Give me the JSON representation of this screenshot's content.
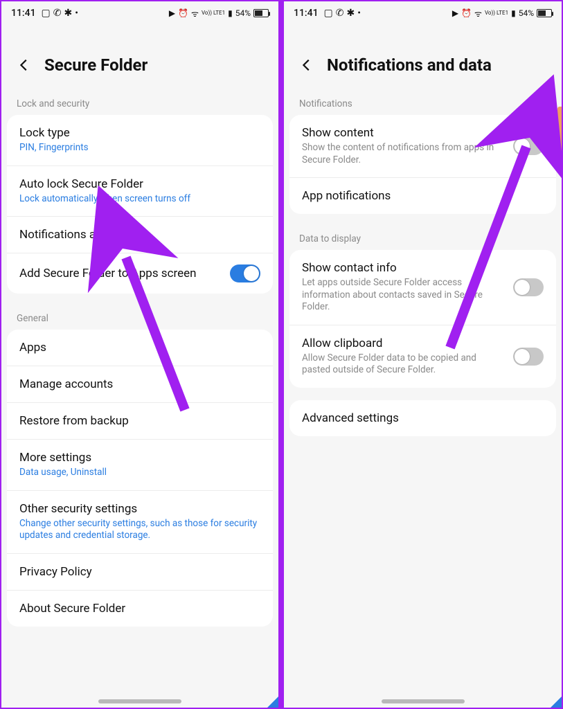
{
  "statusbar": {
    "time": "11:41",
    "battery_text": "54%",
    "net_label": "Vo)) LTE1",
    "left_icons": [
      "image-icon",
      "whatsapp-icon",
      "slack-icon",
      "dot-icon"
    ],
    "right_icons": [
      "youtube-icon",
      "alarm-icon",
      "wifi-icon",
      "net-label",
      "signal-icon"
    ]
  },
  "screens": {
    "left": {
      "title": "Secure Folder",
      "sections": [
        {
          "label": "Lock and security",
          "items": [
            {
              "title": "Lock type",
              "sub": "PIN, Fingerprints",
              "subColor": "blue"
            },
            {
              "title": "Auto lock Secure Folder",
              "sub": "Lock automatically when screen turns off",
              "subColor": "blue"
            },
            {
              "title": "Notifications and data"
            },
            {
              "title": "Add Secure Folder to Apps screen",
              "toggle": "on"
            }
          ]
        },
        {
          "label": "General",
          "items": [
            {
              "title": "Apps"
            },
            {
              "title": "Manage accounts"
            },
            {
              "title": "Restore from backup"
            },
            {
              "title": "More settings",
              "sub": "Data usage, Uninstall",
              "subColor": "blue"
            },
            {
              "title": "Other security settings",
              "sub": "Change other security settings, such as those for security updates and credential storage.",
              "subColor": "blue"
            },
            {
              "title": "Privacy Policy"
            },
            {
              "title": "About Secure Folder"
            }
          ]
        }
      ]
    },
    "right": {
      "title": "Notifications and data",
      "sections": [
        {
          "label": "Notifications",
          "items": [
            {
              "title": "Show content",
              "sub": "Show the content of notifications from apps in Secure Folder.",
              "subColor": "gray",
              "toggle": "off"
            },
            {
              "title": "App notifications"
            }
          ]
        },
        {
          "label": "Data to display",
          "items": [
            {
              "title": "Show contact info",
              "sub": "Let apps outside Secure Folder access information about contacts saved in Secure Folder.",
              "subColor": "gray",
              "toggle": "off"
            },
            {
              "title": "Allow clipboard",
              "sub": "Allow Secure Folder data to be copied and pasted outside of Secure Folder.",
              "subColor": "gray",
              "toggle": "off"
            }
          ]
        },
        {
          "card_only": true,
          "items": [
            {
              "title": "Advanced settings"
            }
          ]
        }
      ]
    }
  },
  "colors": {
    "accent": "#2a7de1",
    "arrow": "#a020f0"
  }
}
